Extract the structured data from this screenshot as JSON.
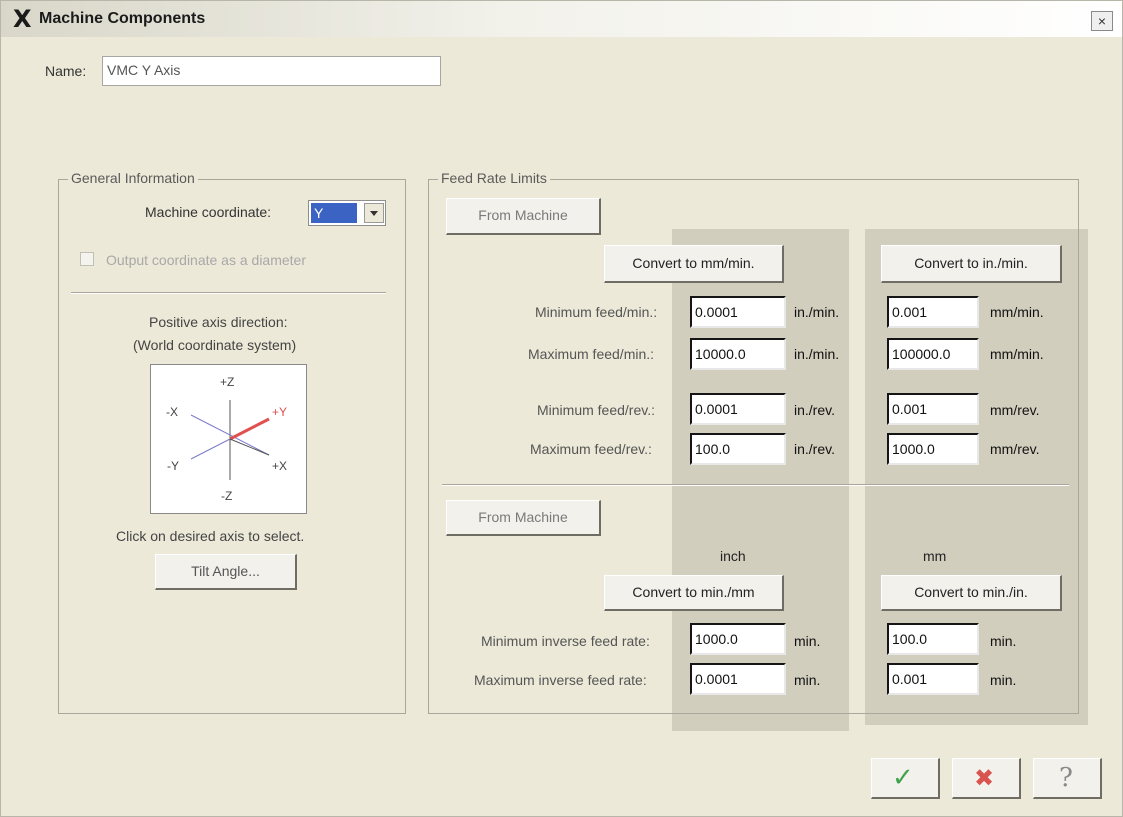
{
  "window": {
    "title": "Machine Components",
    "close_glyph": "×",
    "app_icon": "X"
  },
  "name_field": {
    "label": "Name:",
    "value": "VMC Y Axis"
  },
  "general": {
    "title": "General Information",
    "machine_coord_label": "Machine coordinate:",
    "machine_coord_value": "Y",
    "output_diameter_label": "Output coordinate as a diameter",
    "positive_axis_line1": "Positive axis direction:",
    "positive_axis_line2": "(World coordinate system)",
    "axes": {
      "pz": "+Z",
      "nz": "-Z",
      "px": "+X",
      "nx": "-X",
      "py": "+Y",
      "ny": "-Y",
      "selected": "+Y"
    },
    "click_hint": "Click on desired axis to select.",
    "tilt_button": "Tilt Angle..."
  },
  "feed": {
    "title": "Feed Rate Limits",
    "from_machine_1": "From Machine",
    "from_machine_2": "From Machine",
    "convert_to_mm_min": "Convert to mm/min.",
    "convert_to_in_min": "Convert to in./min.",
    "rows": [
      {
        "label": "Minimum feed/min.:",
        "inch_value": "0.0001",
        "inch_unit": "in./min.",
        "mm_value": "0.001",
        "mm_unit": "mm/min."
      },
      {
        "label": "Maximum feed/min.:",
        "inch_value": "10000.0",
        "inch_unit": "in./min.",
        "mm_value": "100000.0",
        "mm_unit": "mm/min."
      },
      {
        "label": "Minimum feed/rev.:",
        "inch_value": "0.0001",
        "inch_unit": "in./rev.",
        "mm_value": "0.001",
        "mm_unit": "mm/rev."
      },
      {
        "label": "Maximum feed/rev.:",
        "inch_value": "100.0",
        "inch_unit": "in./rev.",
        "mm_value": "1000.0",
        "mm_unit": "mm/rev."
      }
    ],
    "col_inch": "inch",
    "col_mm": "mm",
    "convert_to_min_mm": "Convert to min./mm",
    "convert_to_min_in": "Convert to min./in.",
    "inverse_rows": [
      {
        "label": "Minimum inverse feed rate:",
        "inch_value": "1000.0",
        "inch_unit": "min.",
        "mm_value": "100.0",
        "mm_unit": "min."
      },
      {
        "label": "Maximum inverse feed rate:",
        "inch_value": "0.0001",
        "inch_unit": "min.",
        "mm_value": "0.001",
        "mm_unit": "min."
      }
    ]
  },
  "footer": {
    "ok_icon": "✓",
    "cancel_icon": "✖",
    "help_icon": "?"
  },
  "colors": {
    "selected_axis": "#e05050",
    "ok_green": "#3fa34d",
    "cancel_red": "#d9534f",
    "combo_highlight": "#3b63c4"
  }
}
